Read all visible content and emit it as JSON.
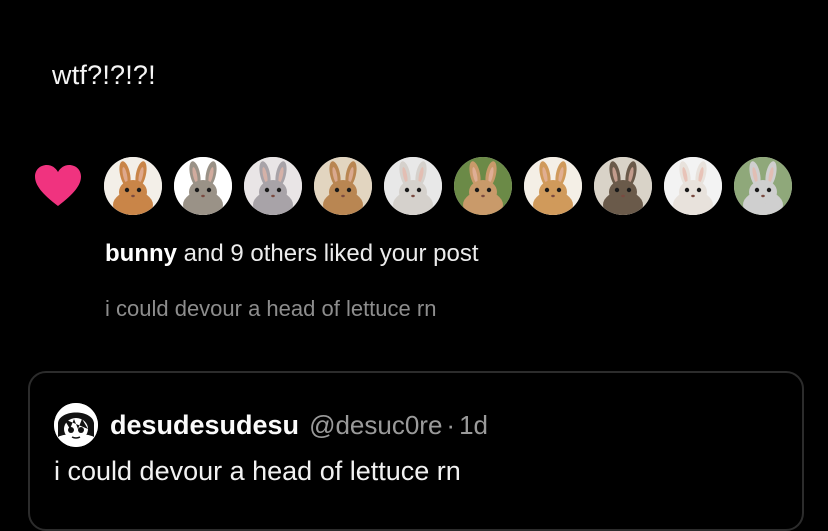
{
  "post": {
    "text": "wtf?!?!?!"
  },
  "notification": {
    "icon": "heart-icon",
    "heart_color": "#f0337f",
    "avatars": [
      {
        "icon": "bunny-avatar-1",
        "bg": "#f3efe8",
        "fur": "#c98548"
      },
      {
        "icon": "bunny-avatar-2",
        "bg": "#ffffff",
        "fur": "#9a9287"
      },
      {
        "icon": "bunny-avatar-3",
        "bg": "#e9e5e6",
        "fur": "#a8a3a8"
      },
      {
        "icon": "bunny-avatar-4",
        "bg": "#e2d5c0",
        "fur": "#b98652"
      },
      {
        "icon": "bunny-avatar-5",
        "bg": "#e8e8e8",
        "fur": "#d5d1cc"
      },
      {
        "icon": "bunny-avatar-6",
        "bg": "#6b8a47",
        "fur": "#c99a6a"
      },
      {
        "icon": "bunny-avatar-7",
        "bg": "#f4efe6",
        "fur": "#d09a5b"
      },
      {
        "icon": "bunny-avatar-8",
        "bg": "#d9d3c8",
        "fur": "#6a5a4a"
      },
      {
        "icon": "bunny-avatar-9",
        "bg": "#f3f3f3",
        "fur": "#e8e2dc"
      },
      {
        "icon": "bunny-avatar-10",
        "bg": "#8fa87a",
        "fur": "#cfcfcf"
      }
    ],
    "liker": "bunny",
    "liked_suffix": " and 9 others liked your post",
    "post_preview": "i could devour a head of lettuce rn"
  },
  "quoted_post": {
    "avatar_icon": "anime-character-avatar",
    "display_name": "desudesudesu",
    "handle": "@desuc0re",
    "separator": "·",
    "time": "1d",
    "text": "i could devour a head of lettuce rn"
  }
}
